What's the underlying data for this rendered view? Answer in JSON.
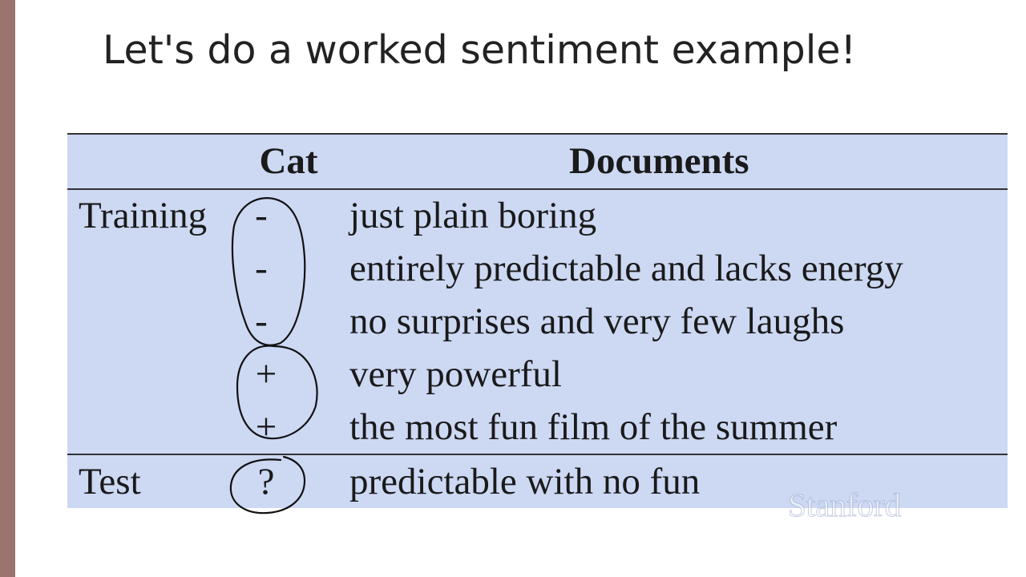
{
  "slide": {
    "title": "Let's do a worked sentiment example!"
  },
  "table": {
    "headers": {
      "set": "",
      "cat": "Cat",
      "documents": "Documents"
    },
    "rows": [
      {
        "set": "Training",
        "cat": "-",
        "doc": "just plain boring"
      },
      {
        "set": "",
        "cat": "-",
        "doc": "entirely predictable and lacks energy"
      },
      {
        "set": "",
        "cat": "-",
        "doc": "no surprises and very few laughs"
      },
      {
        "set": "",
        "cat": "+",
        "doc": "very powerful"
      },
      {
        "set": "",
        "cat": "+",
        "doc": "the most fun film of the summer"
      },
      {
        "set": "Test",
        "cat": "?",
        "doc": "predictable with no fun"
      }
    ]
  },
  "watermark": "Stanford",
  "colors": {
    "table_background": "#cdd8f3",
    "accent_bar": "#9b7470",
    "text": "#1a1a1a"
  }
}
